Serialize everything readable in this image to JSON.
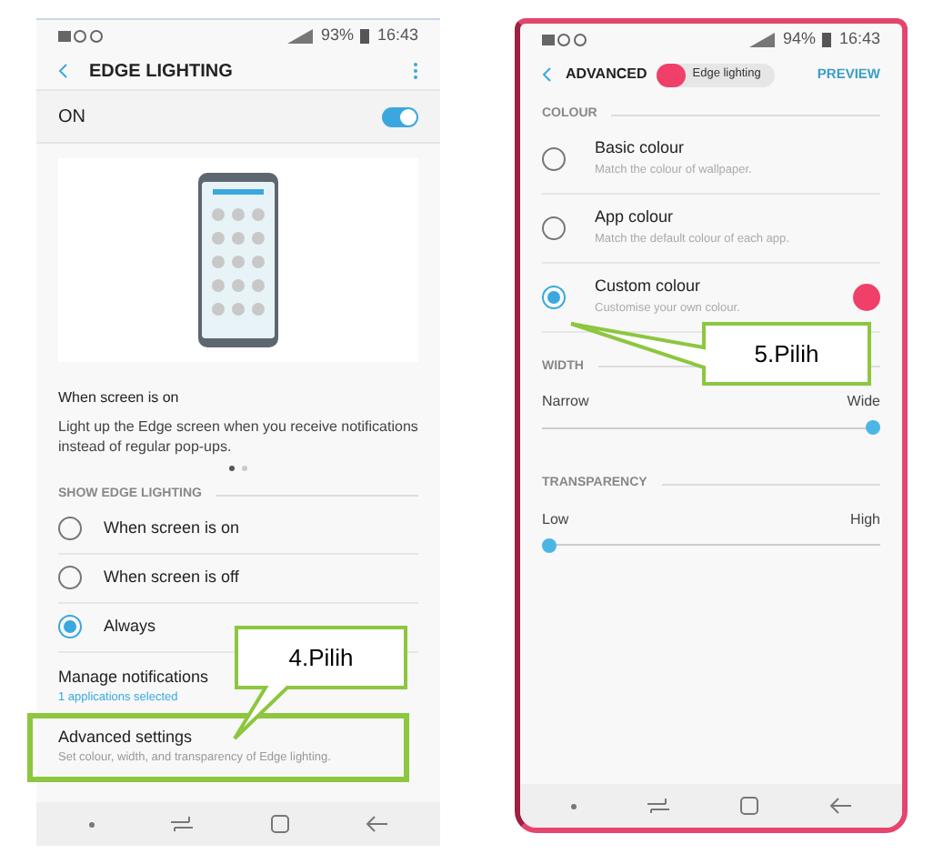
{
  "left_screen": {
    "status_bar": {
      "battery": "93%",
      "time": "16:43"
    },
    "title": "EDGE LIGHTING",
    "master": {
      "label": "ON",
      "on": true
    },
    "caption": {
      "title": "When screen is on",
      "text": "Light up the Edge screen when you receive notifications instead of regular pop-ups."
    },
    "page_dots": [
      {
        "selected": true
      },
      {
        "selected": false
      }
    ],
    "section": "SHOW EDGE LIGHTING",
    "options": [
      {
        "label": "When screen is on",
        "selected": false
      },
      {
        "label": "When screen is off",
        "selected": false
      },
      {
        "label": "Always",
        "selected": true
      }
    ],
    "manage": {
      "title": "Manage notifications",
      "subtitle": "1 applications selected"
    },
    "advanced": {
      "title": "Advanced settings",
      "subtitle": "Set colour, width, and transparency of Edge lighting.",
      "highlighted": true
    }
  },
  "right_screen": {
    "status_bar": {
      "battery": "94%",
      "time": "16:43"
    },
    "title": "ADVANCED",
    "chip": "Edge lighting",
    "action": "PREVIEW",
    "colour_section": "COLOUR",
    "colours": [
      {
        "title": "Basic colour",
        "subtitle": "Match the colour of wallpaper.",
        "selected": false
      },
      {
        "title": "App colour",
        "subtitle": "Match the default colour of each app.",
        "selected": false
      },
      {
        "title": "Custom colour",
        "subtitle": "Customise your own colour.",
        "selected": true,
        "color": "#f0406a"
      }
    ],
    "width": {
      "section": "WIDTH",
      "low": "Narrow",
      "high": "Wide",
      "level": 1
    },
    "transparency": {
      "section": "TRANSPARENCY",
      "low": "Low",
      "high": "High",
      "level": 0
    }
  },
  "callouts": [
    {
      "text": "4.Pilih"
    },
    {
      "text": "5.Pilih"
    }
  ]
}
